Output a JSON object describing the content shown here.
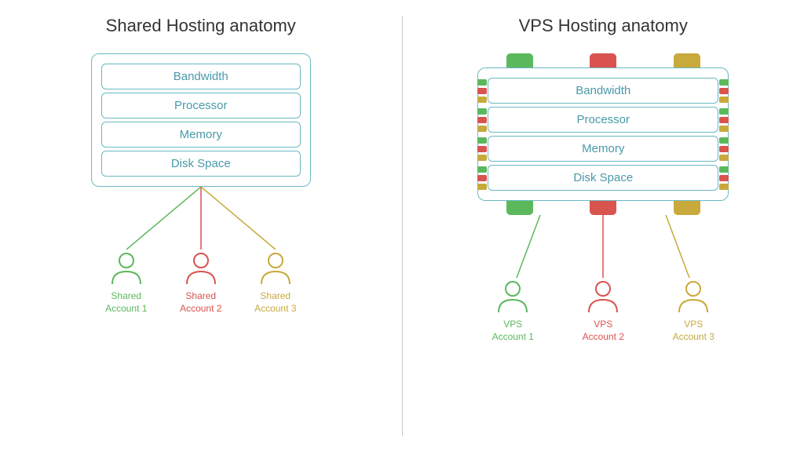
{
  "shared": {
    "title": "Shared Hosting anatomy",
    "resources": [
      "Bandwidth",
      "Processor",
      "Memory",
      "Disk Space"
    ],
    "accounts": [
      {
        "label": "Shared\nAccount 1",
        "color": "green"
      },
      {
        "label": "Shared\nAccount 2",
        "color": "red"
      },
      {
        "label": "Shared\nAccount 3",
        "color": "yellow"
      }
    ]
  },
  "vps": {
    "title": "VPS Hosting anatomy",
    "resources": [
      "Bandwidth",
      "Processor",
      "Memory",
      "Disk Space"
    ],
    "accounts": [
      {
        "label": "VPS\nAccount 1",
        "color": "green"
      },
      {
        "label": "VPS\nAccount 2",
        "color": "red"
      },
      {
        "label": "VPS\nAccount 3",
        "color": "yellow"
      }
    ]
  }
}
